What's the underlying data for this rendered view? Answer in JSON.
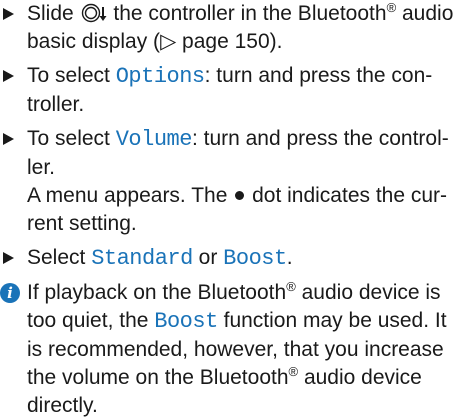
{
  "steps": [
    {
      "parts": [
        "Slide ",
        "the controller in the Bluetooth",
        "®",
        " audio basic display (",
        "▷",
        " page 150)."
      ]
    },
    {
      "pre": "To select ",
      "ui": "Options",
      "post": ": turn and press the con-troller."
    },
    {
      "pre": "To select ",
      "ui": "Volume",
      "post": ": turn and press the control-ler.",
      "result_pre": "A menu appears. The ",
      "result_post": " dot indicates the cur-rent setting."
    },
    {
      "pre": "Select ",
      "ui1": "Standard",
      "mid": " or ",
      "ui2": "Boost",
      "post": "."
    }
  ],
  "info": {
    "icon": "i",
    "text1": "If playback on the Bluetooth",
    "reg": "®",
    "text2": " audio device is too quiet, the ",
    "ui": "Boost",
    "text3": " function may be used. It is recommended, however, that you increase the volume on the Bluetooth",
    "reg2": "®",
    "text4": " audio device directly."
  },
  "icons": {
    "controller": "controller-slide-down-icon",
    "step_marker": "triangle-bullet-icon",
    "info": "info-icon",
    "dot": "filled-dot-icon"
  },
  "colors": {
    "accent": "#1a73b8",
    "text": "#1a1a1a"
  }
}
